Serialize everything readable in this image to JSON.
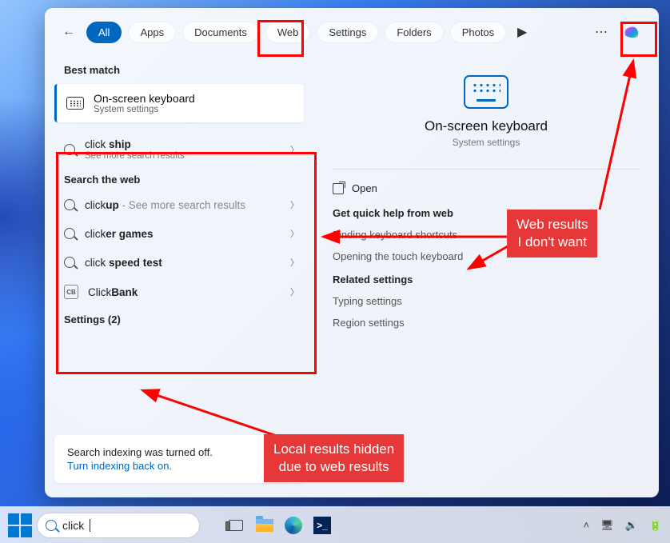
{
  "tabs": {
    "all": "All",
    "apps": "Apps",
    "documents": "Documents",
    "web": "Web",
    "settings": "Settings",
    "folders": "Folders",
    "photos": "Photos"
  },
  "sections": {
    "best_match": "Best match",
    "search_web": "Search the web",
    "settings_count": "Settings (2)"
  },
  "best_match": {
    "title": "On-screen keyboard",
    "subtitle": "System settings"
  },
  "suggestion": {
    "prefix": "click ",
    "bold": "ship",
    "sub": "See more search results"
  },
  "web_results": [
    {
      "prefix": "click",
      "bold": "up",
      "sub": " - See more search results",
      "icon": "search"
    },
    {
      "prefix": "click",
      "bold": "er games",
      "sub": "",
      "icon": "search"
    },
    {
      "prefix": "click ",
      "bold": "speed test",
      "sub": "",
      "icon": "search"
    },
    {
      "prefix": "Click",
      "bold": "Bank",
      "sub": "",
      "icon": "cb"
    }
  ],
  "indexing": {
    "line1": "Search indexing was turned off.",
    "line2": "Turn indexing back on."
  },
  "preview": {
    "title": "On-screen keyboard",
    "subtitle": "System settings",
    "open": "Open",
    "quick_help": "Get quick help from web",
    "help_links": [
      "Finding keyboard shortcuts",
      "Opening the touch keyboard"
    ],
    "related_header": "Related settings",
    "related_links": [
      "Typing settings",
      "Region settings"
    ]
  },
  "annotations": {
    "web_results_label": "Web results\nI don't want",
    "local_hidden_label": "Local results hidden\ndue to web results"
  },
  "taskbar": {
    "search_value": "click"
  }
}
